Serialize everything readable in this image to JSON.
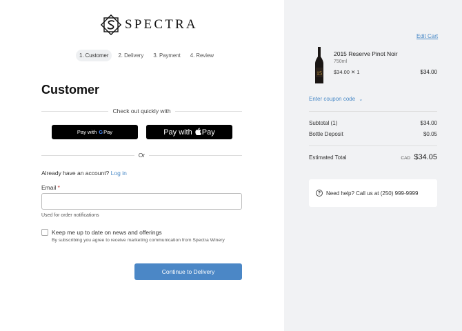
{
  "brand": {
    "name": "SPECTRA"
  },
  "steps": [
    {
      "label": "1. Customer"
    },
    {
      "label": "2. Delivery"
    },
    {
      "label": "3. Payment"
    },
    {
      "label": "4. Review"
    }
  ],
  "page_title": "Customer",
  "checkout": {
    "quick_label": "Check out quickly with",
    "gpay_prefix": "Pay with",
    "gpay_g": "G",
    "gpay_suffix": "Pay",
    "apay_prefix": "Pay with",
    "apay_apple": "",
    "apay_suffix": "Pay",
    "or_label": "Or"
  },
  "account": {
    "prompt": "Already have an account?",
    "login_link": "Log in"
  },
  "email": {
    "label": "Email",
    "required_mark": "*",
    "value": "",
    "placeholder": "",
    "help": "Used for order notifications"
  },
  "newsletter": {
    "label": "Keep me up to date on news and offerings",
    "sub": "By subscribing you agree to receive marketing communication from Spectra Winery",
    "checked": false
  },
  "continue_label": "Continue to Delivery",
  "cart": {
    "edit_label": "Edit Cart",
    "product": {
      "name": "2015 Reserve Pinot Noir",
      "size": "750ml",
      "qty_text": "$34.00 ✕ 1",
      "price": "$34.00"
    },
    "coupon_label": "Enter coupon code",
    "subtotal_label": "Subtotal (1)",
    "subtotal_value": "$34.00",
    "deposit_label": "Bottle Deposit",
    "deposit_value": "$0.05",
    "total_label": "Estimated Total",
    "total_currency": "CAD",
    "total_value": "$34.05"
  },
  "help": {
    "text": "Need help? Call us at (250) 999-9999"
  },
  "colors": {
    "accent": "#4b87c6",
    "link": "#4a8ac7",
    "panel_bg": "#f1f2f4"
  }
}
